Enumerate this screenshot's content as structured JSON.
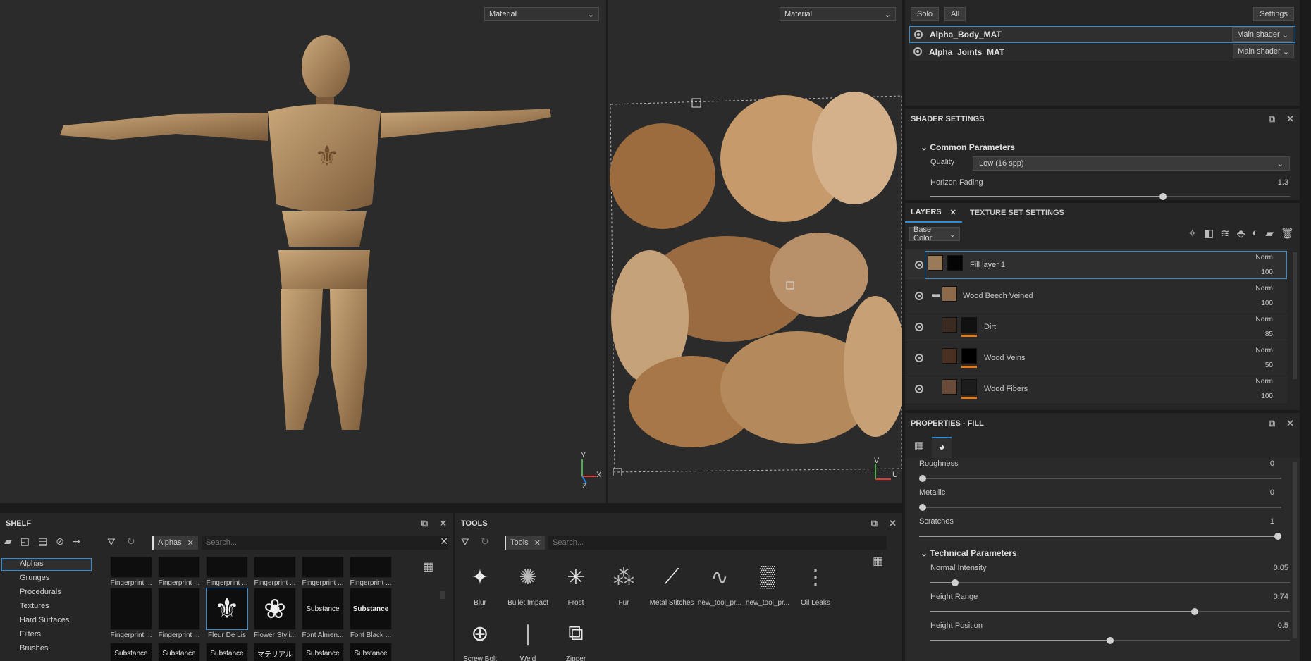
{
  "viewport3d": {
    "select": "Material",
    "axes": {
      "y": "Y",
      "x": "X",
      "z": "Z"
    }
  },
  "viewport2d": {
    "select": "Material",
    "axes": {
      "v": "V",
      "u": "U"
    }
  },
  "texture_sets": {
    "solo": "Solo",
    "all": "All",
    "settings": "Settings",
    "items": [
      {
        "name": "Alpha_Body_MAT",
        "shader": "Main shader"
      },
      {
        "name": "Alpha_Joints_MAT",
        "shader": "Main shader"
      }
    ]
  },
  "shader_settings": {
    "title": "SHADER SETTINGS",
    "group": "Common Parameters",
    "quality_label": "Quality",
    "quality_value": "Low (16 spp)",
    "horizon_label": "Horizon Fading",
    "horizon_value": "1.3",
    "horizon_fraction": 0.65
  },
  "layers": {
    "tab_layers": "LAYERS",
    "tab_texture_set": "TEXTURE SET SETTINGS",
    "channel": "Base Color",
    "items": [
      {
        "name": "Fill layer 1",
        "blend": "Norm",
        "opacity": "100"
      },
      {
        "name": "Wood Beech Veined",
        "blend": "Norm",
        "opacity": "100"
      },
      {
        "name": "Dirt",
        "blend": "Norm",
        "opacity": "85"
      },
      {
        "name": "Wood Veins",
        "blend": "Norm",
        "opacity": "50"
      },
      {
        "name": "Wood Fibers",
        "blend": "Norm",
        "opacity": "100"
      }
    ]
  },
  "properties": {
    "title": "PROPERTIES - FILL",
    "roughness": {
      "label": "Roughness",
      "value": "0",
      "fraction": 0
    },
    "metallic": {
      "label": "Metallic",
      "value": "0",
      "fraction": 0
    },
    "scratches": {
      "label": "Scratches",
      "value": "1",
      "fraction": 1
    },
    "tech_group": "Technical Parameters",
    "normal": {
      "label": "Normal Intensity",
      "value": "0.05",
      "fraction": 0.06
    },
    "height_range": {
      "label": "Height Range",
      "value": "0.74",
      "fraction": 0.74
    },
    "height_position": {
      "label": "Height Position",
      "value": "0.5",
      "fraction": 0.5
    }
  },
  "shelf": {
    "title": "SHELF",
    "filter_tag": "Alphas",
    "search_placeholder": "Search...",
    "categories": [
      "Alphas",
      "Grunges",
      "Procedurals",
      "Textures",
      "Hard Surfaces",
      "Filters",
      "Brushes"
    ],
    "top_row": [
      "Fingerprint ...",
      "Fingerprint ...",
      "Fingerprint ...",
      "Fingerprint ...",
      "Fingerprint ...",
      "Fingerprint ..."
    ],
    "mid_row": [
      {
        "label": "Fingerprint ...",
        "thumb": ""
      },
      {
        "label": "Fingerprint ...",
        "thumb": ""
      },
      {
        "label": "Fleur De Lis",
        "thumb": "⚜"
      },
      {
        "label": "Flower Styli...",
        "thumb": "❀"
      },
      {
        "label": "Font Almen...",
        "thumb": "Substance"
      },
      {
        "label": "Font Black ...",
        "thumb": "Substance"
      }
    ],
    "bottom_row": [
      "Substance",
      "Substance",
      "Substance",
      "マテリアル",
      "Substance",
      "Substance"
    ]
  },
  "tools": {
    "title": "TOOLS",
    "filter_tag": "Tools",
    "search_placeholder": "Search...",
    "row1": [
      "Blur",
      "Bullet Impact",
      "Frost",
      "Fur",
      "Metal Stitches",
      "new_tool_pr...",
      "new_tool_pr...",
      "Oil Leaks"
    ],
    "row2": [
      "Screw Bolt",
      "Weld",
      "Zipper"
    ]
  },
  "colors": {
    "accent": "#2e8fd8",
    "orange": "#e07b1e"
  }
}
